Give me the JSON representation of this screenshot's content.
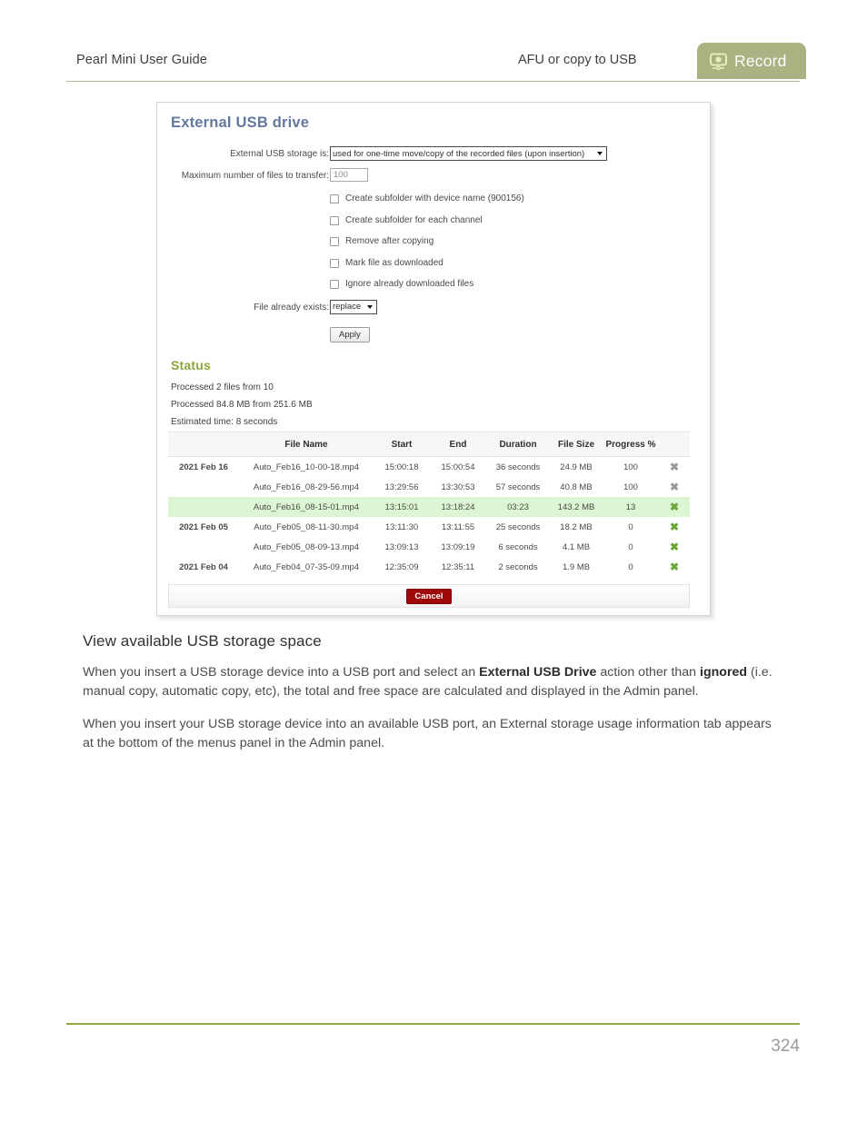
{
  "header": {
    "doc_title": "Pearl Mini User Guide",
    "section": "AFU or copy to USB",
    "tab_label": "Record",
    "tab_icon": "record-video-icon",
    "tab_color": "#a9b281",
    "rule_color": "#bcbb8c"
  },
  "screenshot": {
    "panel_title": "External USB drive",
    "panel_title_color": "#63789e",
    "form": {
      "storage_label": "External USB storage is:",
      "storage_value": "used for one-time move/copy of the recorded files (upon insertion)",
      "max_files_label": "Maximum number of files to transfer:",
      "max_files_value": "100",
      "max_files_placeholder": "100",
      "checkboxes": [
        {
          "label": "Create subfolder with device name (900156)",
          "checked": false
        },
        {
          "label": "Create subfolder for each channel",
          "checked": false
        },
        {
          "label": "Remove after copying",
          "checked": false
        },
        {
          "label": "Mark file as downloaded",
          "checked": false
        },
        {
          "label": "Ignore already downloaded files",
          "checked": false
        }
      ],
      "exists_label": "File already exists:",
      "exists_value": "replace",
      "apply_label": "Apply"
    },
    "status": {
      "title": "Status",
      "title_color": "#8aa63c",
      "line1": "Processed 2 files from 10",
      "line2": "Processed 84.8 MB from 251.6 MB",
      "line3": "Estimated time: 8 seconds"
    },
    "table": {
      "headers": [
        "",
        "File Name",
        "Start",
        "End",
        "Duration",
        "File Size",
        "Progress %",
        ""
      ],
      "rows": [
        {
          "date": "2021 Feb 16",
          "name": "Auto_Feb16_10-00-18.mp4",
          "start": "15:00:18",
          "end": "15:00:54",
          "duration": "36 seconds",
          "size": "24.9 MB",
          "progress": "100",
          "action": "✖",
          "action_state": "done",
          "highlight": false
        },
        {
          "date": "",
          "name": "Auto_Feb16_08-29-56.mp4",
          "start": "13:29:56",
          "end": "13:30:53",
          "duration": "57 seconds",
          "size": "40.8 MB",
          "progress": "100",
          "action": "✖",
          "action_state": "done",
          "highlight": false
        },
        {
          "date": "",
          "name": "Auto_Feb16_08-15-01.mp4",
          "start": "13:15:01",
          "end": "13:18:24",
          "duration": "03:23",
          "size": "143.2 MB",
          "progress": "13",
          "action": "✖",
          "action_state": "active",
          "highlight": true
        },
        {
          "date": "2021 Feb 05",
          "name": "Auto_Feb05_08-11-30.mp4",
          "start": "13:11:30",
          "end": "13:11:55",
          "duration": "25 seconds",
          "size": "18.2 MB",
          "progress": "0",
          "action": "✖",
          "action_state": "active",
          "highlight": false
        },
        {
          "date": "",
          "name": "Auto_Feb05_08-09-13.mp4",
          "start": "13:09:13",
          "end": "13:09:19",
          "duration": "6 seconds",
          "size": "4.1 MB",
          "progress": "0",
          "action": "✖",
          "action_state": "active",
          "highlight": false
        },
        {
          "date": "2021 Feb 04",
          "name": "Auto_Feb04_07-35-09.mp4",
          "start": "12:35:09",
          "end": "12:35:11",
          "duration": "2 seconds",
          "size": "1.9 MB",
          "progress": "0",
          "action": "✖",
          "action_state": "active",
          "highlight": false
        }
      ],
      "cancel_label": "Cancel",
      "highlight_color": "#dcf5d2"
    }
  },
  "content": {
    "heading": "View available USB storage space",
    "para1_a": "When you insert a USB storage device into a USB port and select an ",
    "para1_b": "External USB Drive",
    "para1_c": " action other than ",
    "para1_d": "ignored",
    "para1_e": " (i.e. manual copy, automatic copy, etc), the total and free space are calculated and displayed in the Admin panel.",
    "para2": "When you insert your USB storage device into an available USB port, an External storage usage information tab appears at the bottom of the menus panel in the Admin panel."
  },
  "footer": {
    "page_number": "324",
    "rule_color": "#8fa93d"
  }
}
